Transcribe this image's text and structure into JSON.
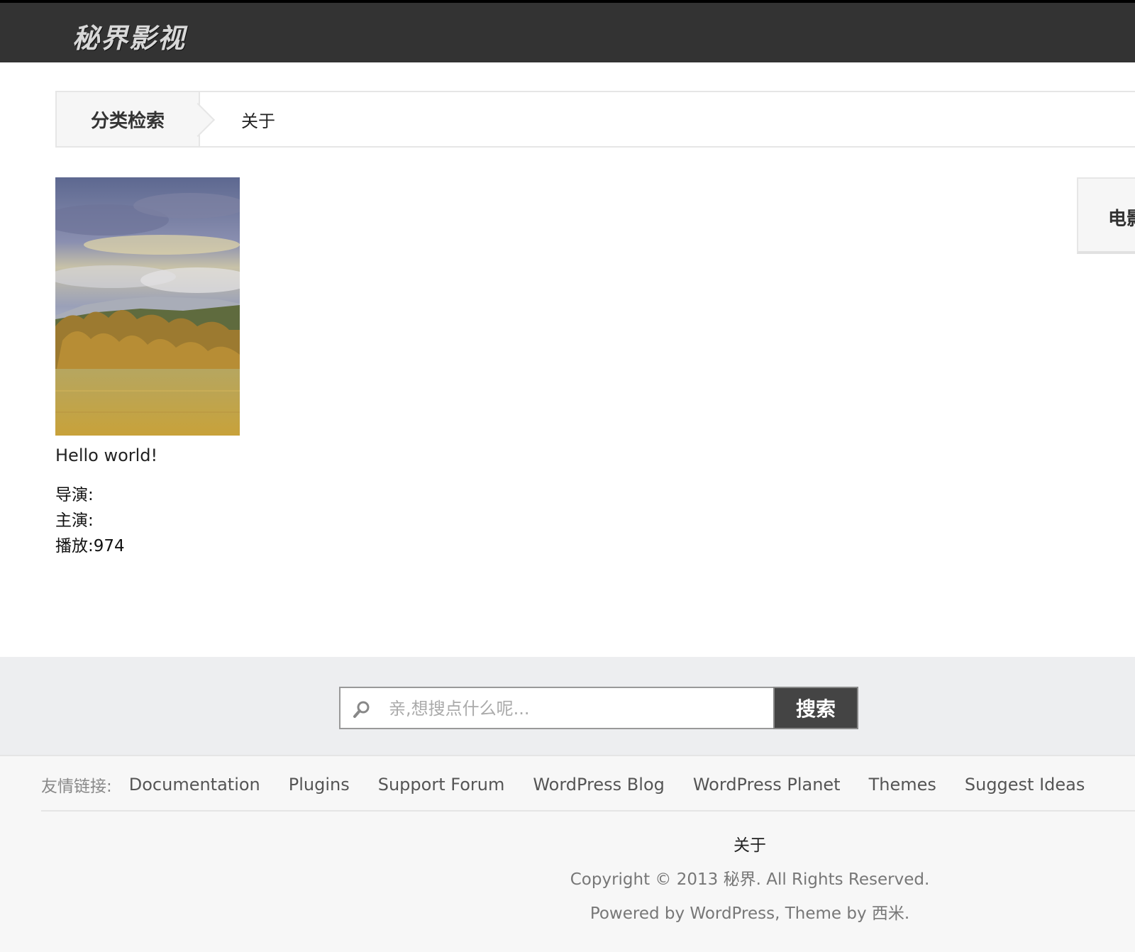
{
  "header": {
    "logo_text": "秘界影视"
  },
  "category_bar": {
    "label": "分类检索",
    "links": [
      "关于"
    ]
  },
  "sidebar": {
    "widget_title": "电影"
  },
  "post": {
    "title": "Hello world!",
    "director_label": "导演:",
    "director_value": "",
    "cast_label": "主演:",
    "cast_value": "",
    "plays_label": "播放:",
    "plays_value": "974"
  },
  "search": {
    "placeholder": "亲,想搜点什么呢...",
    "button_label": "搜索",
    "icon": "search-icon"
  },
  "footer": {
    "links_label": "友情链接:",
    "links": [
      "Documentation",
      "Plugins",
      "Support Forum",
      "WordPress Blog",
      "WordPress Planet",
      "Themes",
      "Suggest Ideas"
    ],
    "about_link": "关于",
    "copyright": "Copyright © 2013 秘界. All Rights Reserved.",
    "powered_by": "Powered by WordPress, Theme by 西米."
  },
  "colors": {
    "header_bg": "#333333",
    "search_button_bg": "#444444",
    "footer_bg": "#f7f7f7",
    "search_band_bg": "#edeef0"
  }
}
